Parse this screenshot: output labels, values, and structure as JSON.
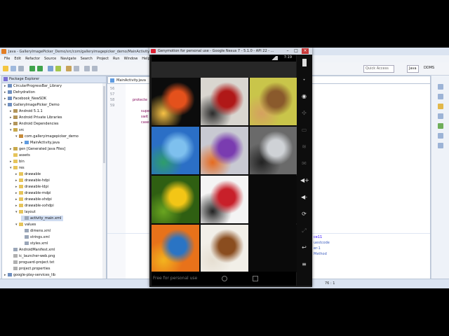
{
  "eclipse": {
    "window_title": "Java - GalleryImagePicker_Demo/src/com/galleryimagepicker_demo/MainActivity.java - Eclipse",
    "menu": [
      "File",
      "Edit",
      "Refactor",
      "Source",
      "Navigate",
      "Search",
      "Project",
      "Run",
      "Window",
      "Help"
    ],
    "quick_access_placeholder": "Quick Access",
    "perspectives": [
      "Java",
      "DDMS"
    ],
    "package_explorer_title": "Package Explorer",
    "tree": [
      {
        "label": "CircularProgressBar_Library",
        "indent": 0,
        "arrow": "▸",
        "type": "project"
      },
      {
        "label": "Dehydration",
        "indent": 0,
        "arrow": "▸",
        "type": "project"
      },
      {
        "label": "Facebook_NewSDK",
        "indent": 0,
        "arrow": "▸",
        "type": "project"
      },
      {
        "label": "GalleryImagePicker_Demo",
        "indent": 0,
        "arrow": "▾",
        "type": "project"
      },
      {
        "label": "Android 5.1.1",
        "indent": 1,
        "arrow": "▸",
        "type": "lib"
      },
      {
        "label": "Android Private Libraries",
        "indent": 1,
        "arrow": "▸",
        "type": "lib"
      },
      {
        "label": "Android Dependencies",
        "indent": 1,
        "arrow": "▸",
        "type": "lib"
      },
      {
        "label": "src",
        "indent": 1,
        "arrow": "▾",
        "type": "src"
      },
      {
        "label": "com.galleryimagepicker_demo",
        "indent": 2,
        "arrow": "▾",
        "type": "pkg"
      },
      {
        "label": "MainActivity.java",
        "indent": 3,
        "arrow": "▸",
        "type": "java"
      },
      {
        "label": "gen [Generated Java Files]",
        "indent": 1,
        "arrow": "▸",
        "type": "src"
      },
      {
        "label": "assets",
        "indent": 1,
        "arrow": "",
        "type": "folder"
      },
      {
        "label": "bin",
        "indent": 1,
        "arrow": "▸",
        "type": "folder"
      },
      {
        "label": "res",
        "indent": 1,
        "arrow": "▾",
        "type": "folder"
      },
      {
        "label": "drawable",
        "indent": 2,
        "arrow": "▸",
        "type": "folder"
      },
      {
        "label": "drawable-hdpi",
        "indent": 2,
        "arrow": "▸",
        "type": "folder"
      },
      {
        "label": "drawable-ldpi",
        "indent": 2,
        "arrow": "▸",
        "type": "folder"
      },
      {
        "label": "drawable-mdpi",
        "indent": 2,
        "arrow": "▸",
        "type": "folder"
      },
      {
        "label": "drawable-xhdpi",
        "indent": 2,
        "arrow": "▸",
        "type": "folder"
      },
      {
        "label": "drawable-xxhdpi",
        "indent": 2,
        "arrow": "▸",
        "type": "folder"
      },
      {
        "label": "layout",
        "indent": 2,
        "arrow": "▾",
        "type": "folder"
      },
      {
        "label": "activity_main.xml",
        "indent": 3,
        "arrow": "",
        "type": "xml",
        "selected": true
      },
      {
        "label": "values",
        "indent": 2,
        "arrow": "▾",
        "type": "folder"
      },
      {
        "label": "dimens.xml",
        "indent": 3,
        "arrow": "",
        "type": "xml"
      },
      {
        "label": "strings.xml",
        "indent": 3,
        "arrow": "",
        "type": "xml"
      },
      {
        "label": "styles.xml",
        "indent": 3,
        "arrow": "",
        "type": "xml"
      },
      {
        "label": "AndroidManifest.xml",
        "indent": 1,
        "arrow": "",
        "type": "xml"
      },
      {
        "label": "ic_launcher-web.png",
        "indent": 1,
        "arrow": "",
        "type": "file"
      },
      {
        "label": "proguard-project.txt",
        "indent": 1,
        "arrow": "",
        "type": "file"
      },
      {
        "label": "project.properties",
        "indent": 1,
        "arrow": "",
        "type": "file"
      },
      {
        "label": "google-play-services_lib",
        "indent": 0,
        "arrow": "▸",
        "type": "project"
      },
      {
        "label": "hellocharts-library",
        "indent": 0,
        "arrow": "▸",
        "type": "project"
      }
    ],
    "editor_tab": "MainActivity.java",
    "line_numbers": [
      "56",
      "57",
      "58",
      "59"
    ],
    "code_lines": [
      {
        "text": "protecte",
        "color": "#7f0055",
        "line": 2
      },
      {
        "text": "supe",
        "color": "#7f0055",
        "line": 4
      },
      {
        "text": "swit",
        "color": "#7f0055",
        "line": 5
      },
      {
        "text": "case",
        "color": "#7f0055",
        "line": 6
      }
    ],
    "right_code": [
      {
        "text": "ce11",
        "line": 0
      },
      {
        "text": "uestcode",
        "line": 1
      },
      {
        "text": "er-1",
        "line": 2
      },
      {
        "text": "Method",
        "line": 3
      }
    ],
    "status_position": "76 : 1"
  },
  "emulator": {
    "title": "Genymotion for personal use - Google Nexus 7 - 5.1.0 - API 22 - ...",
    "status_time": "7:19",
    "watermark": "Free for personal use",
    "side_buttons": [
      "battery-icon",
      "gps-icon",
      "camera-icon",
      "move-icon",
      "id-icon",
      "wifi-icon",
      "sms-icon",
      "volume-up-icon",
      "volume-down-icon",
      "rotate-icon",
      "scale-icon",
      "back-icon",
      "menu-icon"
    ],
    "gps_label": "GPS",
    "images": [
      {
        "name": "fire-abstract-image",
        "colors": [
          "#0c0c0c",
          "#e4511c",
          "#f8c245"
        ]
      },
      {
        "name": "red-machine-image",
        "colors": [
          "#d9d6d0",
          "#b01818",
          "#2b2b2b"
        ]
      },
      {
        "name": "fantasy-creatures-image",
        "colors": [
          "#c9c54a",
          "#8a5a2c",
          "#d5a060"
        ]
      },
      {
        "name": "wave-landscape-image",
        "colors": [
          "#2b6fc6",
          "#7ec0ee",
          "#2e9e6a"
        ]
      },
      {
        "name": "flame-sculpture-image",
        "colors": [
          "#c8c9d2",
          "#7a3cb0",
          "#e56a1f"
        ]
      },
      {
        "name": "silver-car-image",
        "colors": [
          "#6a6a6a",
          "#cfd2d6",
          "#222222"
        ]
      },
      {
        "name": "sunflower-image",
        "colors": [
          "#2f5f12",
          "#f3c616",
          "#6aa520"
        ]
      },
      {
        "name": "cocktail-glasses-image",
        "colors": [
          "#f4f4f4",
          "#c8202a",
          "#222222"
        ]
      },
      {
        "name": "blank-tile",
        "colors": [
          "#0a0a0a",
          "#0a0a0a",
          "#0a0a0a"
        ]
      },
      {
        "name": "orange-flower-image",
        "colors": [
          "#e8721a",
          "#2a74c4",
          "#f3b41e"
        ]
      },
      {
        "name": "coffee-cup-image",
        "colors": [
          "#f2efe8",
          "#8a4d1f",
          "#e6dfd2"
        ]
      },
      {
        "name": "blank-tile",
        "colors": [
          "#0a0a0a",
          "#0a0a0a",
          "#0a0a0a"
        ]
      }
    ]
  }
}
